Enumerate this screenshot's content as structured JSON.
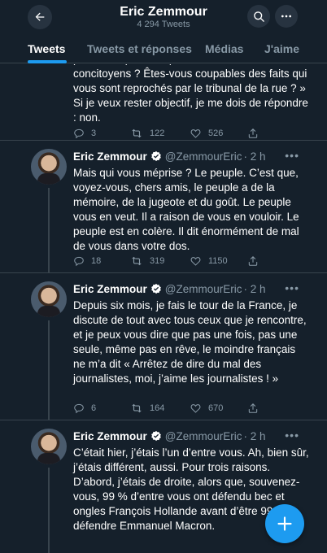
{
  "header": {
    "title": "Eric Zemmour",
    "tweet_count": "4 294 Tweets"
  },
  "tabs": [
    {
      "label": "Tweets",
      "active": true
    },
    {
      "label": "Tweets et réponses",
      "active": false
    },
    {
      "label": "Médias",
      "active": false
    },
    {
      "label": "J'aime",
      "active": false
    }
  ],
  "tweets": [
    {
      "partial": true,
      "text": "concitoyens ? Êtes-vous coupables des faits qui vous sont reprochés par le tribunal de la rue ? » Si je veux rester objectif, je me dois de répondre : non.",
      "replies": "3",
      "retweets": "122",
      "likes": "526"
    },
    {
      "name": "Eric Zemmour",
      "handle": "@ZemmourEric",
      "time": "· 2 h",
      "text": "Mais qui vous méprise ? Le peuple. C’est que, voyez-vous, chers amis, le peuple a de la mémoire, de la jugeote et du goût. Le peuple vous en veut. Il a raison de vous en vouloir. Le peuple est en colère. Il dit énormément de mal de vous dans votre dos.",
      "replies": "18",
      "retweets": "319",
      "likes": "1150"
    },
    {
      "name": "Eric Zemmour",
      "handle": "@ZemmourEric",
      "time": "· 2 h",
      "text": "Depuis six mois, je fais le tour de la France, je discute de tout avec tous ceux que je rencontre, et je peux vous dire que pas une fois, pas une seule, même pas en rêve, le moindre français ne m’a dit « Arrêtez de dire du mal des journalistes, moi, j’aime les journalistes ! »",
      "replies": "6",
      "retweets": "164",
      "likes": "670"
    },
    {
      "name": "Eric Zemmour",
      "handle": "@ZemmourEric",
      "time": "· 2 h",
      "text": "C’était hier, j’étais l’un d’entre vous. Ah, bien sûr, j’étais différent, aussi. Pour trois raisons. D’abord, j’étais de droite, alors que, souvenez-vous, 99 % d’entre vous ont défendu bec et ongles François Hollande avant d’être 99 % à défendre Emmanuel Macron."
    }
  ],
  "icons": {
    "back": "arrow-left-icon",
    "search": "search-icon",
    "more": "more-icon",
    "verified": "verified-badge-icon",
    "reply": "reply-icon",
    "retweet": "retweet-icon",
    "like": "heart-icon",
    "share": "share-icon",
    "compose": "plus-icon"
  },
  "colors": {
    "background": "#15202b",
    "accent": "#1d9bf0",
    "muted": "#8899a6",
    "divider": "#38444d"
  }
}
